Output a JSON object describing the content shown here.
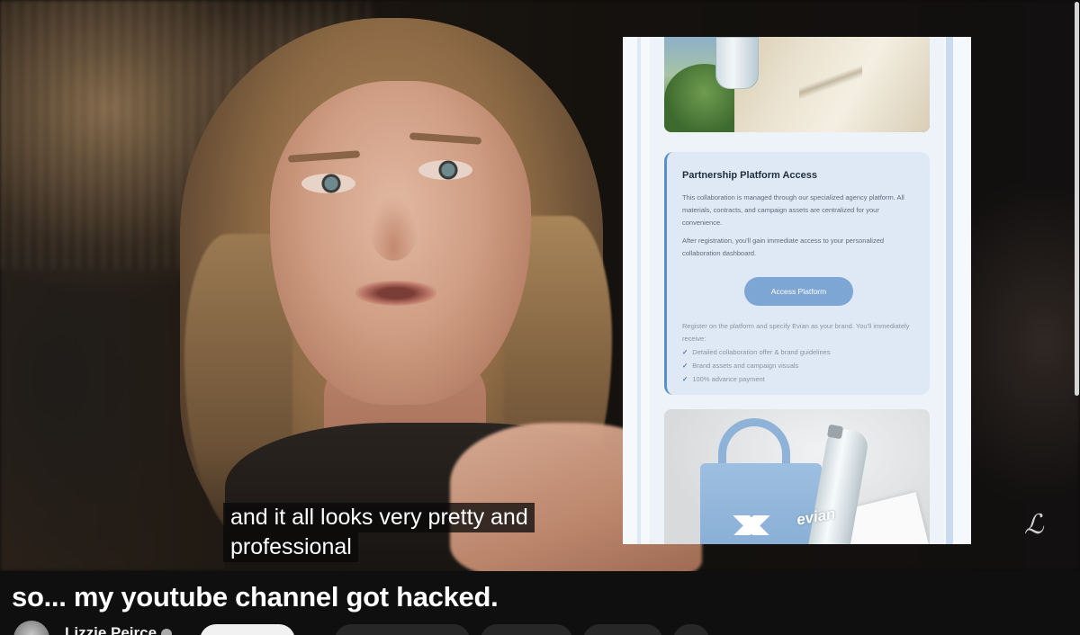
{
  "email": {
    "card_title": "Partnership Platform Access",
    "paragraph_1": "This collaboration is managed through our specialized agency platform. All materials, contracts, and campaign assets are centralized for your convenience.",
    "paragraph_2": "After registration, you'll gain immediate access to your personalized collaboration dashboard.",
    "button_label": "Access Platform",
    "intro": "Register on the platform and specify Evian as your brand. You'll immediately receive:",
    "benefits": [
      "Detailed collaboration offer & brand guidelines",
      "Brand assets and campaign visuals",
      "100% advance payment"
    ],
    "check_glyph": "✓",
    "bottle_brand": "evian"
  },
  "captions": {
    "line_1": "and it all looks very pretty and",
    "line_2": "professional"
  },
  "video": {
    "title": "so... my youtube channel got hacked."
  },
  "channel": {
    "name": "Lizzie Peirce"
  },
  "colors": {
    "button_blue": "#7ea6d4",
    "card_accent": "#5b8fc7",
    "page_background": "#0f0f0f"
  }
}
